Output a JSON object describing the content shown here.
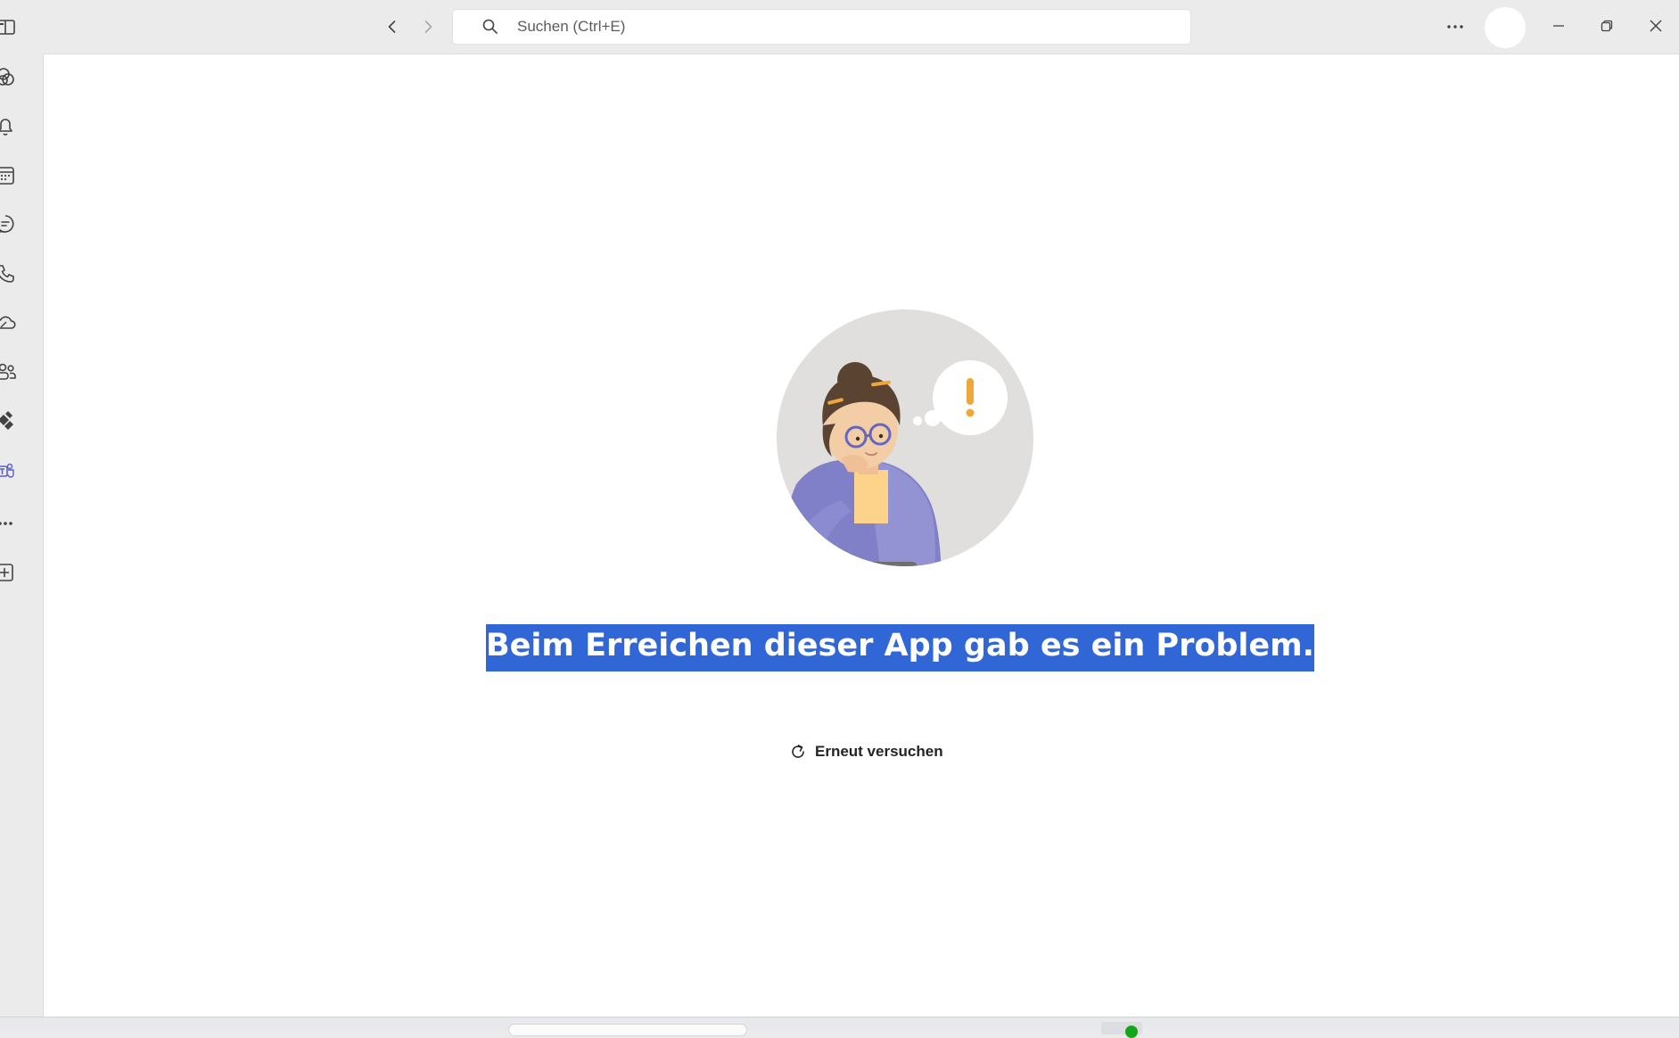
{
  "titlebar": {
    "search_placeholder": "Suchen (Ctrl+E)",
    "icons": [
      "sidebar-toggle-icon",
      "back-arrow-icon",
      "forward-arrow-icon",
      "search-icon",
      "more-options-icon",
      "minimize-icon",
      "restore-icon",
      "close-icon"
    ]
  },
  "rail": {
    "items": [
      "copilot-icon",
      "bell-icon",
      "calendar-icon",
      "chat-icon",
      "phone-icon",
      "onedrive-icon",
      "people-icon",
      "apps-icon",
      "teams-icon",
      "more-apps-icon",
      "add-app-icon"
    ],
    "active_color": "#5b5fc7"
  },
  "main": {
    "error_message": "Beim Erreichen dieser App gab es ein Problem.",
    "retry_label": "Erneut versuchen",
    "selection_color": "#3166d6"
  }
}
